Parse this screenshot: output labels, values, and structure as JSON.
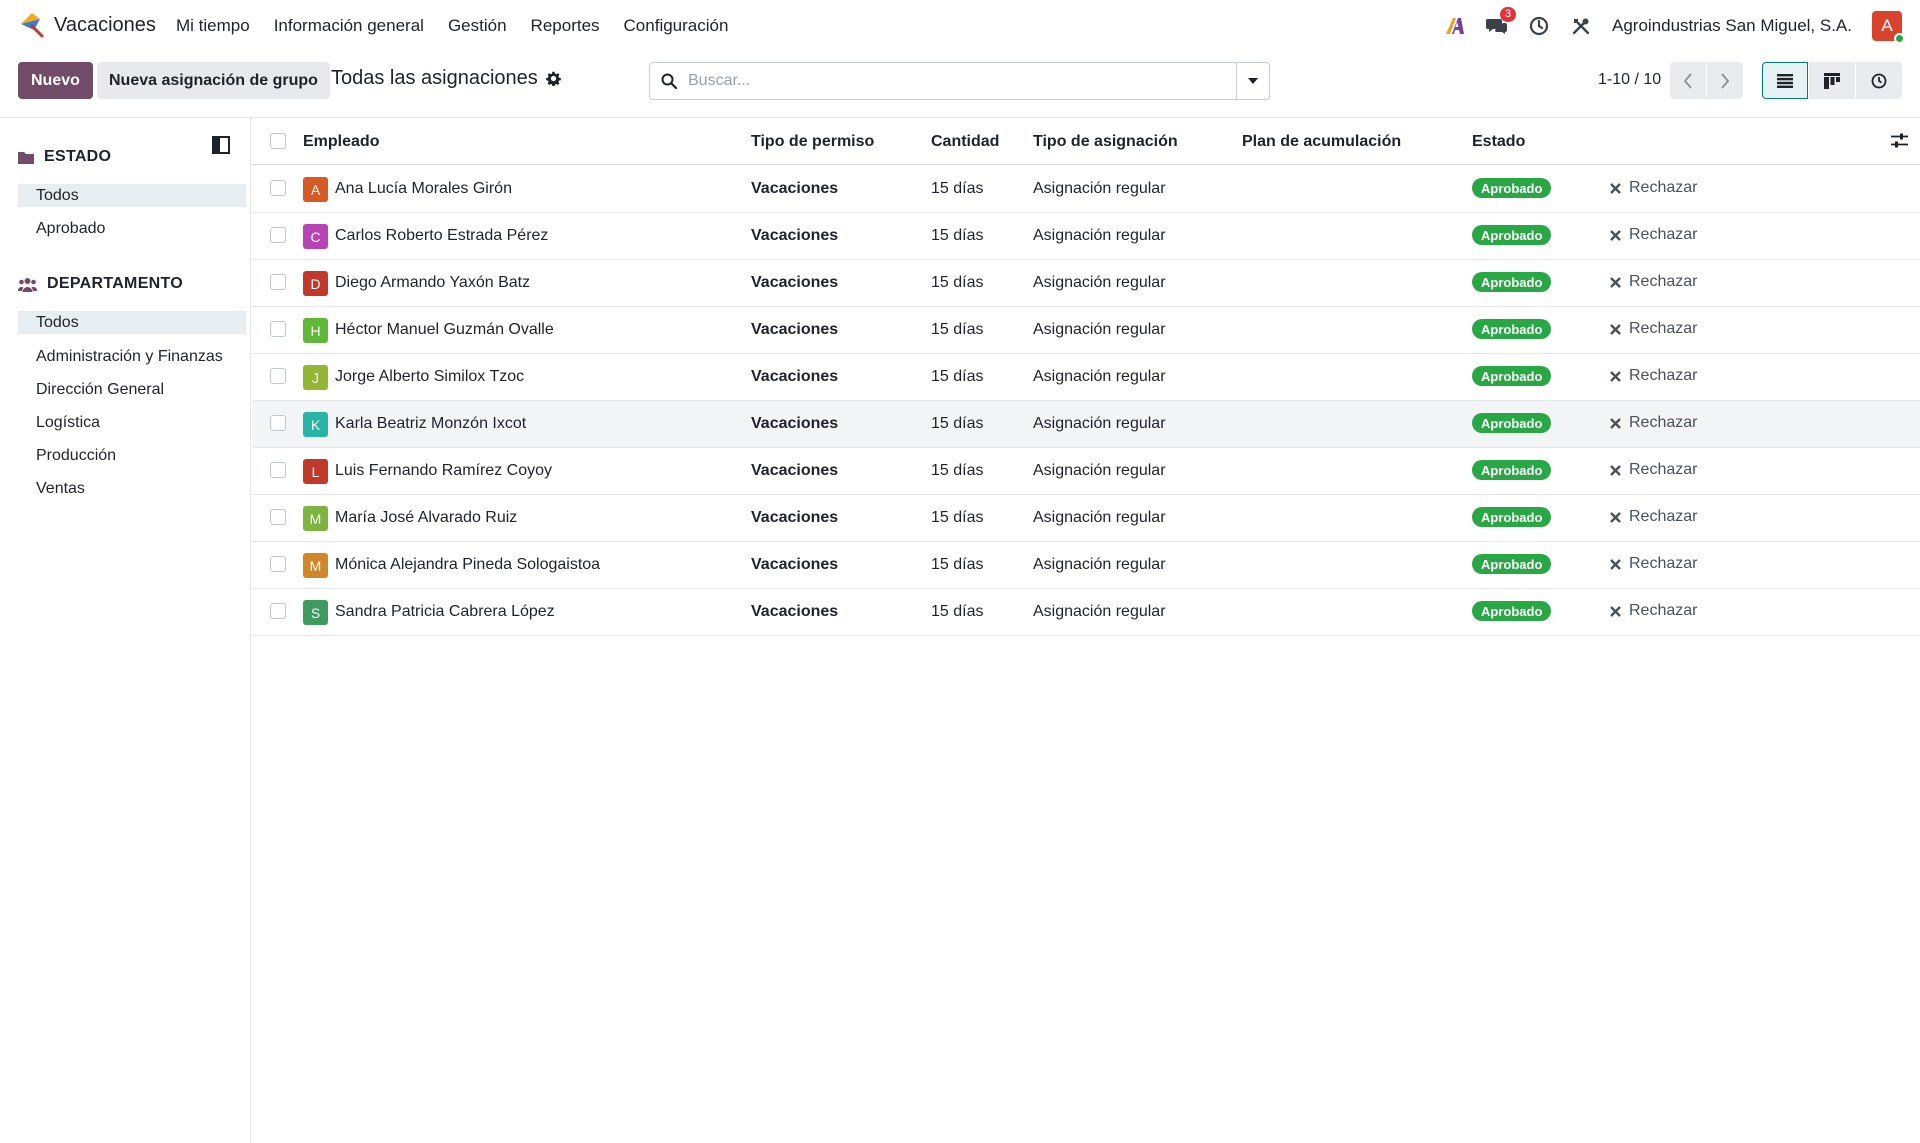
{
  "app": {
    "name": "Vacaciones",
    "menu": [
      "Mi tiempo",
      "Información general",
      "Gestión",
      "Reportes",
      "Configuración"
    ],
    "company": "Agroindustrias San Miguel, S.A.",
    "message_count": "3",
    "user_initial": "A",
    "brand_color": "#714b67"
  },
  "control": {
    "new_label": "Nuevo",
    "group_label": "Nueva asignación de grupo",
    "breadcrumb": "Todas las asignaciones",
    "search_placeholder": "Buscar...",
    "pager": "1-10 / 10"
  },
  "sidebar": {
    "status": {
      "title": "ESTADO",
      "items": [
        "Todos",
        "Aprobado"
      ]
    },
    "department": {
      "title": "DEPARTAMENTO",
      "items": [
        "Todos",
        "Administración y Finanzas",
        "Dirección General",
        "Logística",
        "Producción",
        "Ventas"
      ]
    }
  },
  "table": {
    "headers": {
      "employee": "Empleado",
      "leave_type": "Tipo de permiso",
      "amount": "Cantidad",
      "allocation_type": "Tipo de asignación",
      "accrual_plan": "Plan de acumulación",
      "state": "Estado"
    },
    "reject_label": "Rechazar",
    "rows": [
      {
        "initial": "A",
        "color": "#d65a23",
        "employee": "Ana Lucía Morales Girón",
        "leave_type": "Vacaciones",
        "amount": "15 días",
        "allocation_type": "Asignación regular",
        "state": "Aprobado"
      },
      {
        "initial": "C",
        "color": "#b843b5",
        "employee": "Carlos Roberto Estrada Pérez",
        "leave_type": "Vacaciones",
        "amount": "15 días",
        "allocation_type": "Asignación regular",
        "state": "Aprobado"
      },
      {
        "initial": "D",
        "color": "#c0392b",
        "employee": "Diego Armando Yaxón Batz",
        "leave_type": "Vacaciones",
        "amount": "15 días",
        "allocation_type": "Asignación regular",
        "state": "Aprobado"
      },
      {
        "initial": "H",
        "color": "#5fb83a",
        "employee": "Héctor Manuel Guzmán Ovalle",
        "leave_type": "Vacaciones",
        "amount": "15 días",
        "allocation_type": "Asignación regular",
        "state": "Aprobado"
      },
      {
        "initial": "J",
        "color": "#93b636",
        "employee": "Jorge Alberto Similox Tzoc",
        "leave_type": "Vacaciones",
        "amount": "15 días",
        "allocation_type": "Asignación regular",
        "state": "Aprobado"
      },
      {
        "initial": "K",
        "color": "#28b5a6",
        "employee": "Karla Beatriz Monzón Ixcot",
        "leave_type": "Vacaciones",
        "amount": "15 días",
        "allocation_type": "Asignación regular",
        "state": "Aprobado"
      },
      {
        "initial": "L",
        "color": "#c0392b",
        "employee": "Luis Fernando Ramírez Coyoy",
        "leave_type": "Vacaciones",
        "amount": "15 días",
        "allocation_type": "Asignación regular",
        "state": "Aprobado"
      },
      {
        "initial": "M",
        "color": "#7db33e",
        "employee": "María José Alvarado Ruiz",
        "leave_type": "Vacaciones",
        "amount": "15 días",
        "allocation_type": "Asignación regular",
        "state": "Aprobado"
      },
      {
        "initial": "M",
        "color": "#d2862a",
        "employee": "Mónica Alejandra Pineda Sologaistoa",
        "leave_type": "Vacaciones",
        "amount": "15 días",
        "allocation_type": "Asignación regular",
        "state": "Aprobado"
      },
      {
        "initial": "S",
        "color": "#3e9a5d",
        "employee": "Sandra Patricia Cabrera López",
        "leave_type": "Vacaciones",
        "amount": "15 días",
        "allocation_type": "Asignación regular",
        "state": "Aprobado"
      }
    ]
  }
}
